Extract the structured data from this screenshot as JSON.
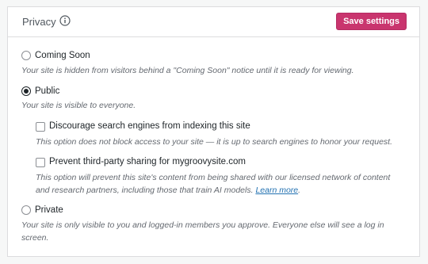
{
  "header": {
    "title": "Privacy",
    "save_label": "Save settings"
  },
  "colors": {
    "accent": "#c9356e",
    "link": "#2271b1"
  },
  "options": {
    "coming_soon": {
      "label": "Coming Soon",
      "checked": false,
      "description": "Your site is hidden from visitors behind a \"Coming Soon\" notice until it is ready for viewing."
    },
    "public": {
      "label": "Public",
      "checked": true,
      "description": "Your site is visible to everyone.",
      "discourage": {
        "label": "Discourage search engines from indexing this site",
        "checked": false,
        "description": "This option does not block access to your site — it is up to search engines to honor your request."
      },
      "prevent_sharing": {
        "label": "Prevent third-party sharing for mygroovysite.com",
        "checked": false,
        "description_line1": "This option will prevent this site's content from being shared with our licensed network of content",
        "description_line2": "and research partners, including those that train AI models.",
        "learn_more": "Learn more",
        "after_link": "."
      }
    },
    "private": {
      "label": "Private",
      "checked": false,
      "description_line1": "Your site is only visible to you and logged-in members you approve. Everyone else will see a log in",
      "description_line2": "screen."
    }
  }
}
